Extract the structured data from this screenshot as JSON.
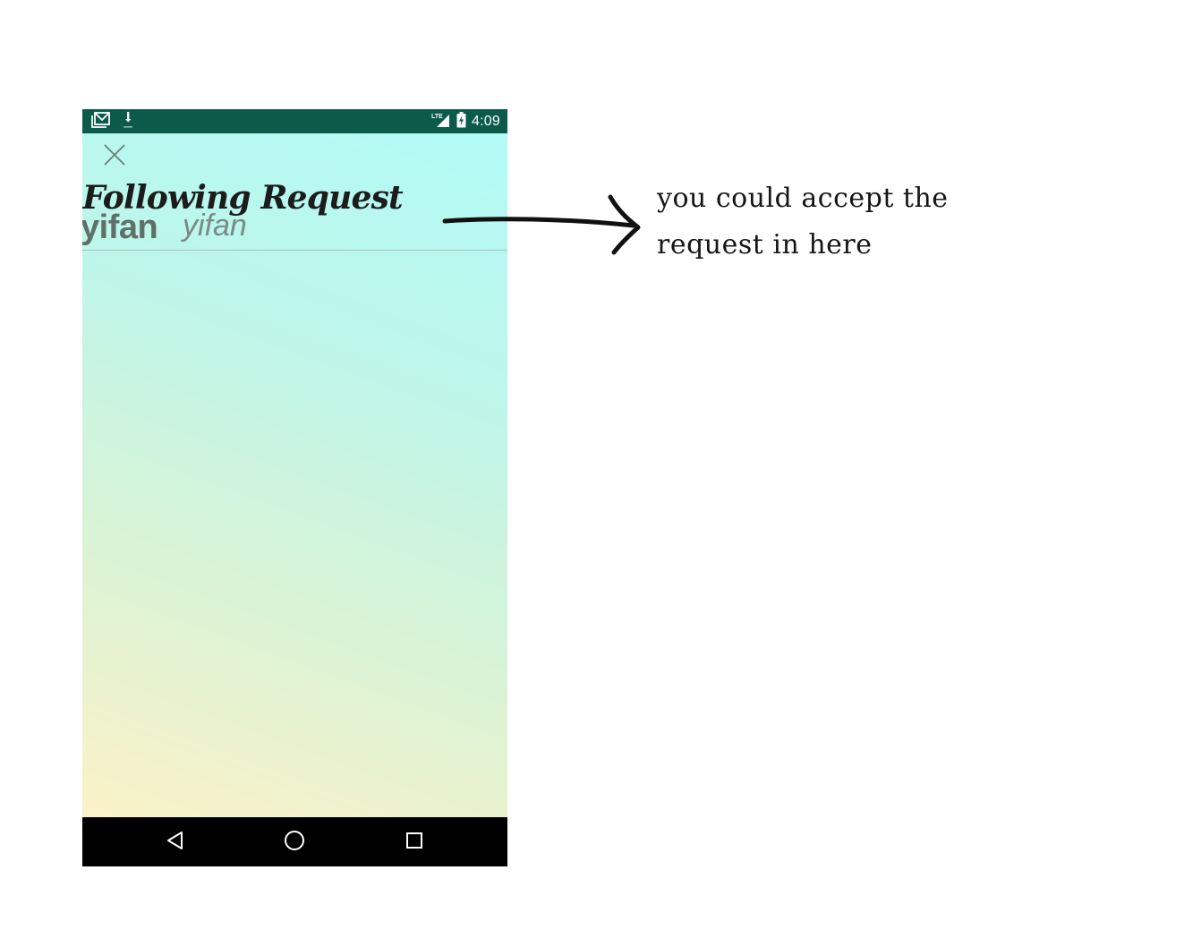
{
  "status_bar": {
    "time": "4:09",
    "left_icons": [
      "gmail-icon",
      "download-icon"
    ],
    "right_icons": [
      "lte-signal-icon",
      "battery-charging-icon"
    ],
    "network_label": "LTE",
    "background_color": "#0b5a4a"
  },
  "screen": {
    "close_icon": "close-icon",
    "title": "Following Request",
    "request_item": {
      "name": "yifan",
      "subtitle": "yifan"
    }
  },
  "nav_bar": {
    "icons": [
      "back-icon",
      "home-icon",
      "recents-icon"
    ]
  },
  "annotation": {
    "text": "you could accept the request in here"
  }
}
